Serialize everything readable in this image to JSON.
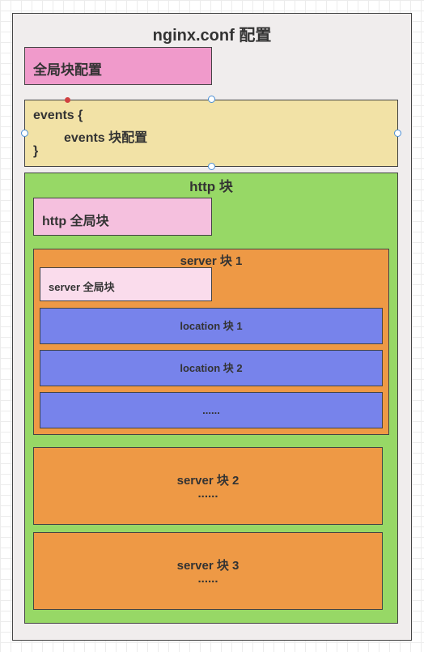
{
  "diagram": {
    "title": "nginx.conf 配置",
    "global_block": "全局块配置",
    "events": {
      "line1": "events {",
      "line2": "events 块配置",
      "line3": "}"
    },
    "http": {
      "title": "http 块",
      "global": "http 全局块",
      "server1": {
        "title": "server 块 1",
        "global": "server 全局块",
        "locations": [
          "location 块 1",
          "location 块 2",
          "......"
        ]
      },
      "server2": {
        "title": "server 块 2",
        "ellipsis": "......"
      },
      "server3": {
        "title": "server 块 3",
        "ellipsis": "......"
      }
    }
  },
  "colors": {
    "outer_fill": "#f0eded",
    "global_fill": "#f09acb",
    "events_fill": "#f2e2a6",
    "http_fill": "#97d866",
    "http_global_fill": "#f5c0de",
    "server_fill": "#ee9945",
    "server_global_fill": "#fadcec",
    "location_fill": "#7783eb",
    "selection_handle": "#4a8fd6"
  }
}
